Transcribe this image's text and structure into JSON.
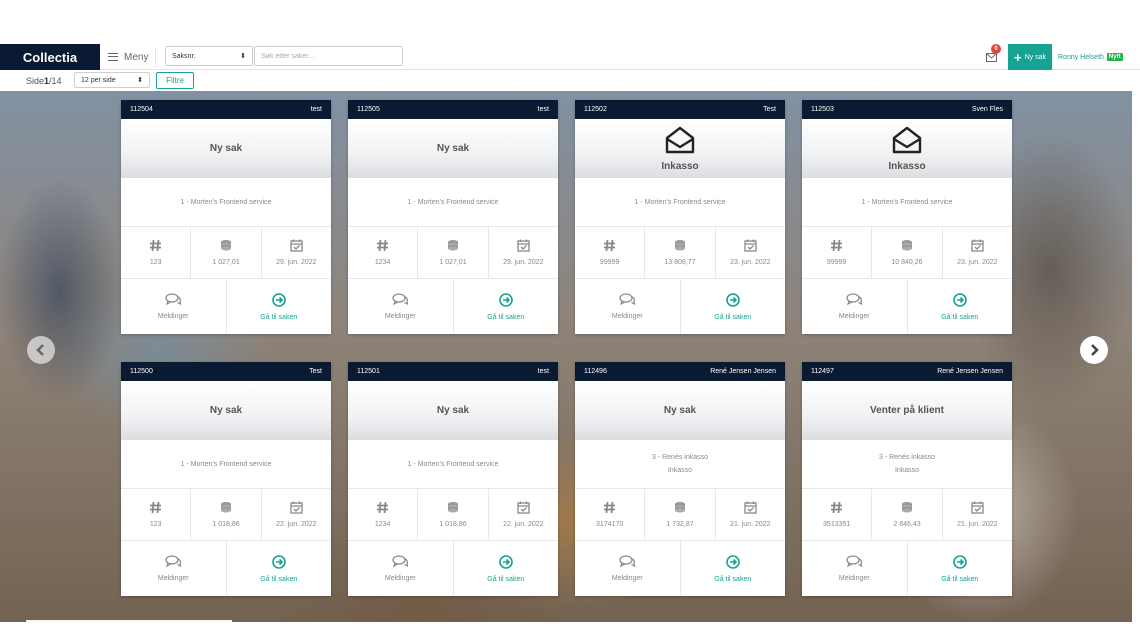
{
  "header": {
    "brand": "Collectia",
    "menu_label": "Meny",
    "search_select": "Saksnr.",
    "search_placeholder": "Søk etter saker...",
    "notification_count": "0",
    "new_case_label": "Ny sak",
    "user_name": "Ronny Helseth",
    "new_tag": "Nytt"
  },
  "toolbar": {
    "page_prefix": "Side ",
    "page_current": "1",
    "page_total": "/14",
    "per_page": "12 per side",
    "filter_label": "Filtre"
  },
  "colors": {
    "navy": "#0b1a33",
    "teal": "#17a391",
    "badge": "#e0443e",
    "tag": "#24b24b"
  },
  "icons": {
    "stat_1": "hash-icon",
    "stat_2": "coins-icon",
    "stat_3": "calendar-check-icon",
    "messages": "chat-icon",
    "goto": "arrow-circle-right-icon",
    "status": "envelope-open-icon"
  },
  "cards": [
    {
      "id": "112504",
      "owner": "test",
      "status": "Ny sak",
      "status_icon": false,
      "service": "1 - Morten's Frontend service",
      "service_sub": "",
      "ref": "123",
      "amount": "1 027,01",
      "date": "29. jun. 2022",
      "messages": "Meldinger",
      "goto": "Gå til saken"
    },
    {
      "id": "112505",
      "owner": "test",
      "status": "Ny sak",
      "status_icon": false,
      "service": "1 - Morten's Frontend service",
      "service_sub": "",
      "ref": "1234",
      "amount": "1 027,01",
      "date": "29. jun. 2022",
      "messages": "Meldinger",
      "goto": "Gå til saken"
    },
    {
      "id": "112502",
      "owner": "Test",
      "status": "Inkasso",
      "status_icon": true,
      "service": "1 - Morten's Frontend service",
      "service_sub": "",
      "ref": "99999",
      "amount": "13 808,77",
      "date": "23. jun. 2022",
      "messages": "Meldinger",
      "goto": "Gå til saken"
    },
    {
      "id": "112503",
      "owner": "Sven Fles",
      "status": "Inkasso",
      "status_icon": true,
      "service": "1 - Morten's Frontend service",
      "service_sub": "",
      "ref": "99999",
      "amount": "10 840,26",
      "date": "23. jun. 2022",
      "messages": "Meldinger",
      "goto": "Gå til saken"
    },
    {
      "id": "112500",
      "owner": "Test",
      "status": "Ny sak",
      "status_icon": false,
      "service": "1 - Morten's Frontend service",
      "service_sub": "",
      "ref": "123",
      "amount": "1 018,86",
      "date": "22. jun. 2022",
      "messages": "Meldinger",
      "goto": "Gå til saken"
    },
    {
      "id": "112501",
      "owner": "test",
      "status": "Ny sak",
      "status_icon": false,
      "service": "1 - Morten's Frontend service",
      "service_sub": "",
      "ref": "1234",
      "amount": "1 018,86",
      "date": "22. jun. 2022",
      "messages": "Meldinger",
      "goto": "Gå til saken"
    },
    {
      "id": "112496",
      "owner": "René Jensen Jensen",
      "status": "Ny sak",
      "status_icon": false,
      "service": "3 - Renés inkasso",
      "service_sub": "Inkasso",
      "ref": "3174170",
      "amount": "1 732,87",
      "date": "21. jun. 2022",
      "messages": "Meldinger",
      "goto": "Gå til saken"
    },
    {
      "id": "112497",
      "owner": "René Jensen Jensen",
      "status": "Venter på klient",
      "status_icon": false,
      "service": "3 - Renés inkasso",
      "service_sub": "Inkasso",
      "ref": "3513351",
      "amount": "2 846,43",
      "date": "21. jun. 2022",
      "messages": "Meldinger",
      "goto": "Gå til saken"
    }
  ]
}
